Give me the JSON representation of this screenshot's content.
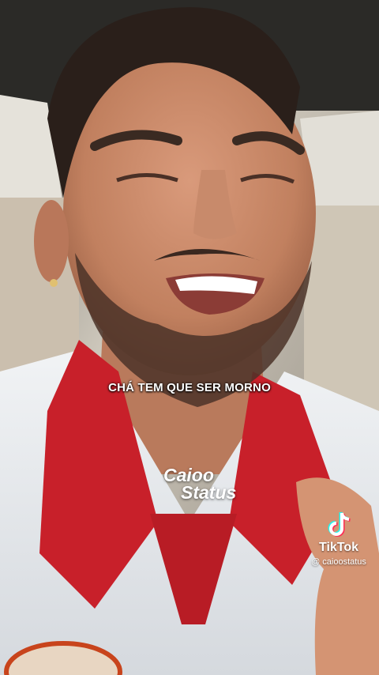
{
  "video": {
    "caption": "CHÁ TEM QUE SER MORNO",
    "watermark_line1": "Caioo",
    "watermark_line2": "Status"
  },
  "tiktok": {
    "icon": "tiktok-logo-icon",
    "brand": "TikTok",
    "handle": "@ caioostatus"
  },
  "colors": {
    "shirt_red": "#c8202a",
    "shirt_white": "#e9ecef",
    "skin": "#c98a6c",
    "background_car": "#d8d2c6"
  }
}
